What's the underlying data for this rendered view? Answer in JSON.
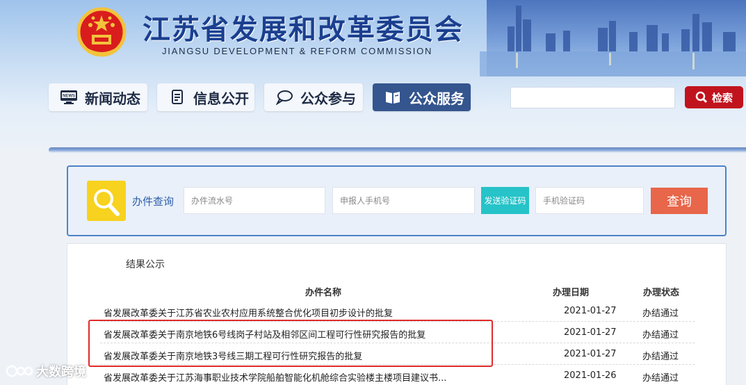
{
  "header": {
    "title": "江苏省发展和改革委员会",
    "subtitle": "JIANGSU DEVELOPMENT & REFORM COMMISSION",
    "nav": [
      {
        "label": "新闻动态",
        "icon": "news-icon"
      },
      {
        "label": "信息公开",
        "icon": "document-icon"
      },
      {
        "label": "公众参与",
        "icon": "chat-bubble-icon"
      },
      {
        "label": "公众服务",
        "icon": "book-icon",
        "active": true
      }
    ],
    "search_button": "检索",
    "search_placeholder": ""
  },
  "query": {
    "label": "办件查询",
    "serial_placeholder": "办件流水号",
    "phone_placeholder": "申报人手机号",
    "send_code": "发送验证码",
    "code_placeholder": "手机验证码",
    "submit": "查询"
  },
  "results": {
    "title": "结果公示",
    "columns": {
      "name": "办件名称",
      "date": "办理日期",
      "status": "办理状态"
    },
    "rows": [
      {
        "name": "省发展改革委关于江苏省农业农村应用系统整合优化项目初步设计的批复",
        "date": "2021-01-27",
        "status": "办结通过"
      },
      {
        "name": "省发展改革委关于南京地铁6号线岗子村站及相邻区间工程可行性研究报告的批复",
        "date": "2021-01-27",
        "status": "办结通过"
      },
      {
        "name": "省发展改革委关于南京地铁3号线三期工程可行性研究报告的批复",
        "date": "2021-01-27",
        "status": "办结通过"
      },
      {
        "name": "省发展改革委关于江苏海事职业技术学院船舶智能化机舱综合实验楼主楼项目建议书...",
        "date": "2021-01-26",
        "status": "办结通过"
      }
    ]
  },
  "watermark": "大数跨境",
  "colors": {
    "brand_blue": "#1b3f8f",
    "search_red": "#c1131d",
    "send_code_teal": "#26c3c8",
    "query_orange": "#e8664a",
    "highlight_red": "#e02b2b"
  }
}
